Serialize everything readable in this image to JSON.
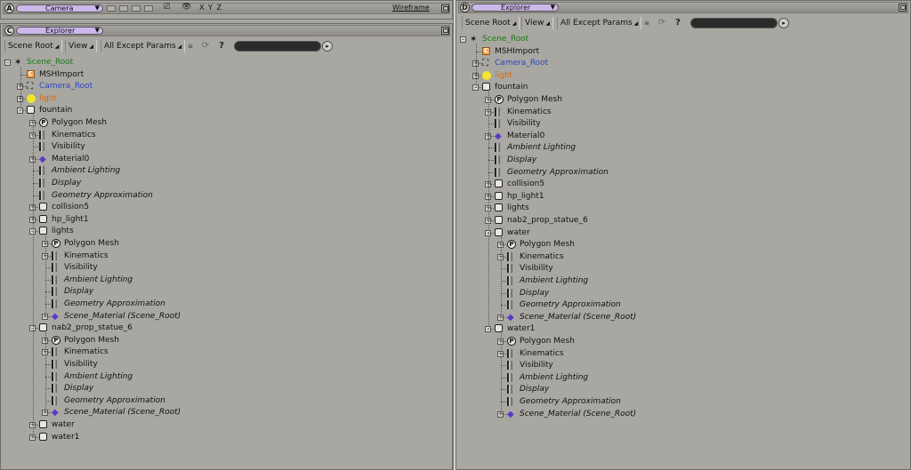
{
  "camera_viewport": {
    "letter": "A",
    "title": "Camera",
    "axes": "X Y Z",
    "mode": "Wireframe"
  },
  "left_explorer": {
    "letter": "C",
    "title": "Explorer",
    "toolbar": {
      "scope": "Scene Root",
      "view": "View",
      "filter": "All Except Params"
    },
    "tree": [
      {
        "label": "Scene_Root",
        "color": "green",
        "icon": "scene-root-icon",
        "expander": "−",
        "depth": 0
      },
      {
        "label": "MSHImport",
        "icon": "constraint-icon",
        "expander": "",
        "depth": 1
      },
      {
        "label": "Camera_Root",
        "color": "blue",
        "icon": "camera-icon",
        "expander": "+",
        "depth": 1
      },
      {
        "label": "light",
        "color": "orange",
        "icon": "light-icon",
        "expander": "+",
        "depth": 1
      },
      {
        "label": "fountain",
        "icon": "group-icon",
        "expander": "−",
        "depth": 1
      },
      {
        "label": "Polygon Mesh",
        "icon": "polygon-mesh-icon",
        "expander": "+",
        "depth": 2
      },
      {
        "label": "Kinematics",
        "icon": "property-icon",
        "expander": "+",
        "depth": 2
      },
      {
        "label": "Visibility",
        "icon": "property-icon",
        "expander": "",
        "depth": 2
      },
      {
        "label": "Material0",
        "icon": "material-icon",
        "expander": "+",
        "depth": 2
      },
      {
        "label": "Ambient Lighting",
        "italic": true,
        "icon": "property-icon",
        "expander": "",
        "depth": 2
      },
      {
        "label": "Display",
        "italic": true,
        "icon": "property-icon",
        "expander": "",
        "depth": 2
      },
      {
        "label": "Geometry Approximation",
        "italic": true,
        "icon": "property-icon",
        "expander": "",
        "depth": 2
      },
      {
        "label": "collision5",
        "icon": "group-icon",
        "expander": "+",
        "depth": 2
      },
      {
        "label": "hp_light1",
        "icon": "group-icon",
        "expander": "+",
        "depth": 2
      },
      {
        "label": "lights",
        "icon": "group-icon",
        "expander": "−",
        "depth": 2
      },
      {
        "label": "Polygon Mesh",
        "icon": "polygon-mesh-icon",
        "expander": "+",
        "depth": 3
      },
      {
        "label": "Kinematics",
        "icon": "property-icon",
        "expander": "+",
        "depth": 3
      },
      {
        "label": "Visibility",
        "icon": "property-icon",
        "expander": "",
        "depth": 3
      },
      {
        "label": "Ambient Lighting",
        "italic": true,
        "icon": "property-icon",
        "expander": "",
        "depth": 3
      },
      {
        "label": "Display",
        "italic": true,
        "icon": "property-icon",
        "expander": "",
        "depth": 3
      },
      {
        "label": "Geometry Approximation",
        "italic": true,
        "icon": "property-icon",
        "expander": "",
        "depth": 3
      },
      {
        "label": "Scene_Material (Scene_Root)",
        "italic": true,
        "icon": "material-icon",
        "expander": "+",
        "depth": 3
      },
      {
        "label": "nab2_prop_statue_6",
        "icon": "group-icon",
        "expander": "−",
        "depth": 2
      },
      {
        "label": "Polygon Mesh",
        "icon": "polygon-mesh-icon",
        "expander": "+",
        "depth": 3
      },
      {
        "label": "Kinematics",
        "icon": "property-icon",
        "expander": "+",
        "depth": 3
      },
      {
        "label": "Visibility",
        "icon": "property-icon",
        "expander": "",
        "depth": 3
      },
      {
        "label": "Ambient Lighting",
        "italic": true,
        "icon": "property-icon",
        "expander": "",
        "depth": 3
      },
      {
        "label": "Display",
        "italic": true,
        "icon": "property-icon",
        "expander": "",
        "depth": 3
      },
      {
        "label": "Geometry Approximation",
        "italic": true,
        "icon": "property-icon",
        "expander": "",
        "depth": 3
      },
      {
        "label": "Scene_Material (Scene_Root)",
        "italic": true,
        "icon": "material-icon",
        "expander": "+",
        "depth": 3
      },
      {
        "label": "water",
        "icon": "group-icon",
        "expander": "+",
        "depth": 2
      },
      {
        "label": "water1",
        "icon": "group-icon",
        "expander": "+",
        "depth": 2
      }
    ]
  },
  "right_explorer": {
    "letter": "D",
    "title": "Explorer",
    "toolbar": {
      "scope": "Scene Root",
      "view": "View",
      "filter": "All Except Params"
    },
    "tree": [
      {
        "label": "Scene_Root",
        "color": "green",
        "icon": "scene-root-icon",
        "expander": "−",
        "depth": 0
      },
      {
        "label": "MSHImport",
        "icon": "constraint-icon",
        "expander": "",
        "depth": 1
      },
      {
        "label": "Camera_Root",
        "color": "blue",
        "icon": "camera-icon",
        "expander": "+",
        "depth": 1
      },
      {
        "label": "light",
        "color": "orange",
        "icon": "light-icon",
        "expander": "+",
        "depth": 1
      },
      {
        "label": "fountain",
        "icon": "group-icon",
        "expander": "−",
        "depth": 1
      },
      {
        "label": "Polygon Mesh",
        "icon": "polygon-mesh-icon",
        "expander": "+",
        "depth": 2
      },
      {
        "label": "Kinematics",
        "icon": "property-icon",
        "expander": "+",
        "depth": 2
      },
      {
        "label": "Visibility",
        "icon": "property-icon",
        "expander": "",
        "depth": 2
      },
      {
        "label": "Material0",
        "icon": "material-icon",
        "expander": "+",
        "depth": 2
      },
      {
        "label": "Ambient Lighting",
        "italic": true,
        "icon": "property-icon",
        "expander": "",
        "depth": 2
      },
      {
        "label": "Display",
        "italic": true,
        "icon": "property-icon",
        "expander": "",
        "depth": 2
      },
      {
        "label": "Geometry Approximation",
        "italic": true,
        "icon": "property-icon",
        "expander": "",
        "depth": 2
      },
      {
        "label": "collision5",
        "icon": "group-icon",
        "expander": "+",
        "depth": 2
      },
      {
        "label": "hp_light1",
        "icon": "group-icon",
        "expander": "+",
        "depth": 2
      },
      {
        "label": "lights",
        "icon": "group-icon",
        "expander": "+",
        "depth": 2
      },
      {
        "label": "nab2_prop_statue_6",
        "icon": "group-icon",
        "expander": "+",
        "depth": 2
      },
      {
        "label": "water",
        "icon": "group-icon",
        "expander": "−",
        "depth": 2
      },
      {
        "label": "Polygon Mesh",
        "icon": "polygon-mesh-icon",
        "expander": "+",
        "depth": 3
      },
      {
        "label": "Kinematics",
        "icon": "property-icon",
        "expander": "+",
        "depth": 3
      },
      {
        "label": "Visibility",
        "icon": "property-icon",
        "expander": "",
        "depth": 3
      },
      {
        "label": "Ambient Lighting",
        "italic": true,
        "icon": "property-icon",
        "expander": "",
        "depth": 3
      },
      {
        "label": "Display",
        "italic": true,
        "icon": "property-icon",
        "expander": "",
        "depth": 3
      },
      {
        "label": "Geometry Approximation",
        "italic": true,
        "icon": "property-icon",
        "expander": "",
        "depth": 3
      },
      {
        "label": "Scene_Material (Scene_Root)",
        "italic": true,
        "icon": "material-icon",
        "expander": "+",
        "depth": 3
      },
      {
        "label": "water1",
        "icon": "group-icon",
        "expander": "−",
        "depth": 2
      },
      {
        "label": "Polygon Mesh",
        "icon": "polygon-mesh-icon",
        "expander": "+",
        "depth": 3
      },
      {
        "label": "Kinematics",
        "icon": "property-icon",
        "expander": "+",
        "depth": 3
      },
      {
        "label": "Visibility",
        "icon": "property-icon",
        "expander": "",
        "depth": 3
      },
      {
        "label": "Ambient Lighting",
        "italic": true,
        "icon": "property-icon",
        "expander": "",
        "depth": 3
      },
      {
        "label": "Display",
        "italic": true,
        "icon": "property-icon",
        "expander": "",
        "depth": 3
      },
      {
        "label": "Geometry Approximation",
        "italic": true,
        "icon": "property-icon",
        "expander": "",
        "depth": 3
      },
      {
        "label": "Scene_Material (Scene_Root)",
        "italic": true,
        "icon": "material-icon",
        "expander": "+",
        "depth": 3
      }
    ]
  },
  "colors": {
    "green": "#1d7b18",
    "blue": "#2a48c6",
    "orange": "#d06a16",
    "title_pill": "#ccb8ea"
  }
}
